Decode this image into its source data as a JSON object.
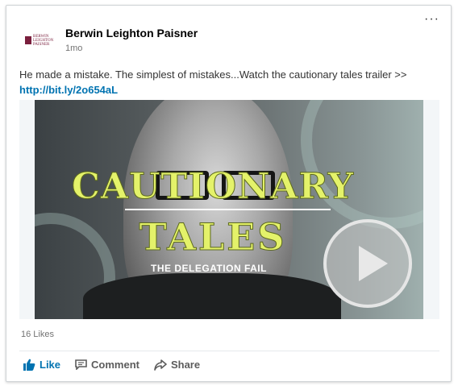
{
  "post": {
    "author": "Berwin Leighton Paisner",
    "logo_text_1": "BERWIN",
    "logo_text_2": "LEIGHTON",
    "logo_text_3": "PAISNER",
    "time": "1mo",
    "text": "He made a mistake. The simplest of mistakes...Watch the cautionary tales trailer >>",
    "link": "http://bit.ly/2o654aL",
    "more_label": "···"
  },
  "video": {
    "title_line_1": "CAUTIONARY",
    "title_line_2": "TALES",
    "subtitle": "THE DELEGATION FAIL",
    "play_icon": "play-icon"
  },
  "social": {
    "likes": "16 Likes"
  },
  "actions": {
    "like": "Like",
    "comment": "Comment",
    "share": "Share"
  },
  "colors": {
    "accent": "#0073b1",
    "title_yellow": "#e4f26a",
    "brand": "#7a1f3d"
  }
}
